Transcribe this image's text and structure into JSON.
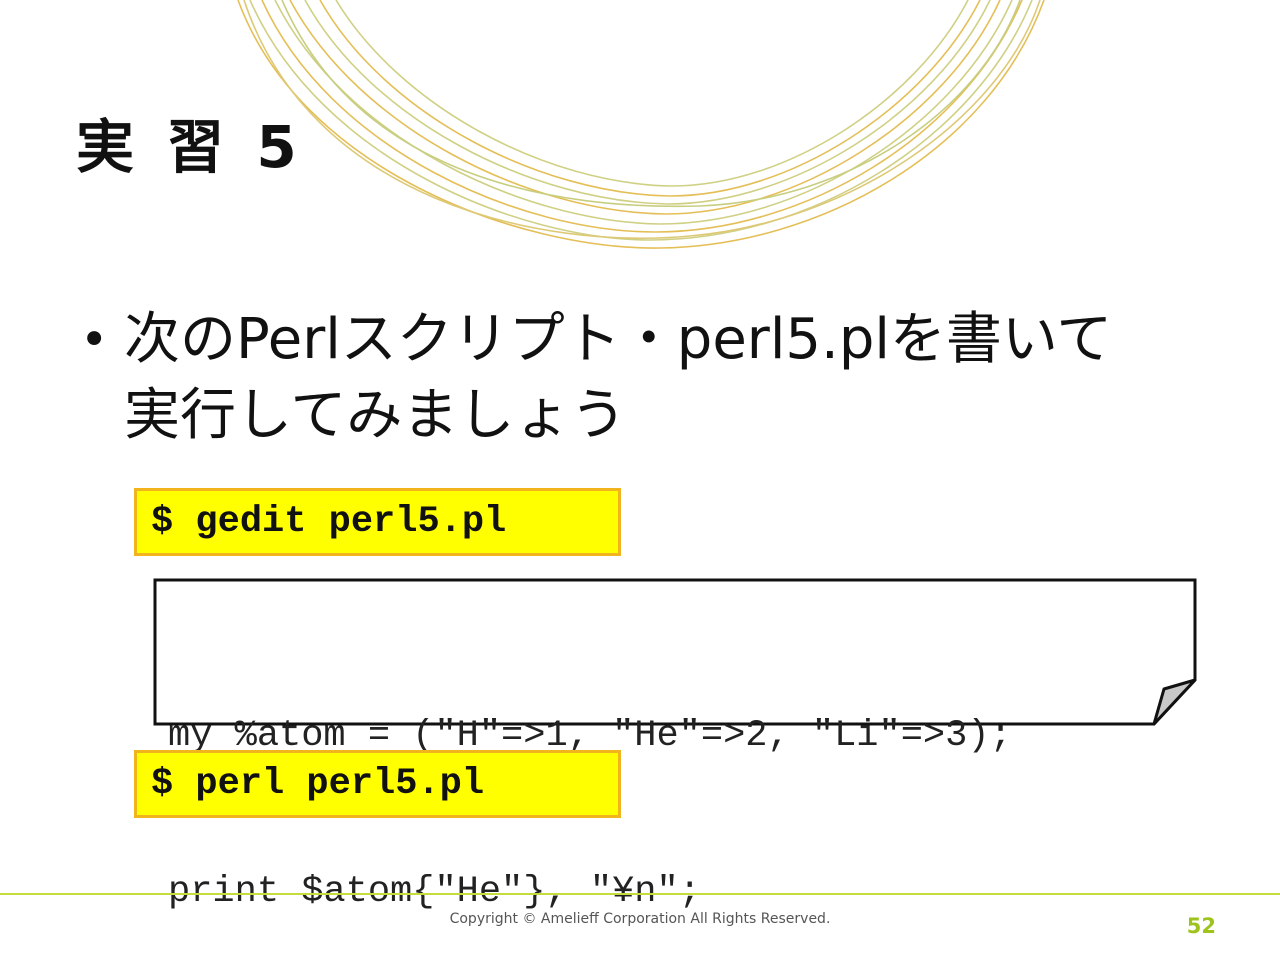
{
  "slide": {
    "title": "実 習 5",
    "bullet": "次のPerlスクリプト・perl5.plを書いて\n実行してみましょう",
    "bullet_marker": "•"
  },
  "commands": {
    "edit": "$ gedit perl5.pl",
    "run": "$ perl perl5.pl"
  },
  "code": {
    "line1": "my %atom = (\"H\"=>1, \"He\"=>2, \"Li\"=>3);",
    "line2": "print $atom{\"He\"}, \"¥n\";"
  },
  "footer": {
    "copyright": "Copyright © Amelieff Corporation All Rights Reserved.",
    "page_number": "52"
  },
  "colors": {
    "command_fill": "#ffff00",
    "command_border": "#f2b41c",
    "accent_green": "#9fc31d",
    "ring_gold": "#e0b43c",
    "ring_olive": "#c8c870"
  }
}
